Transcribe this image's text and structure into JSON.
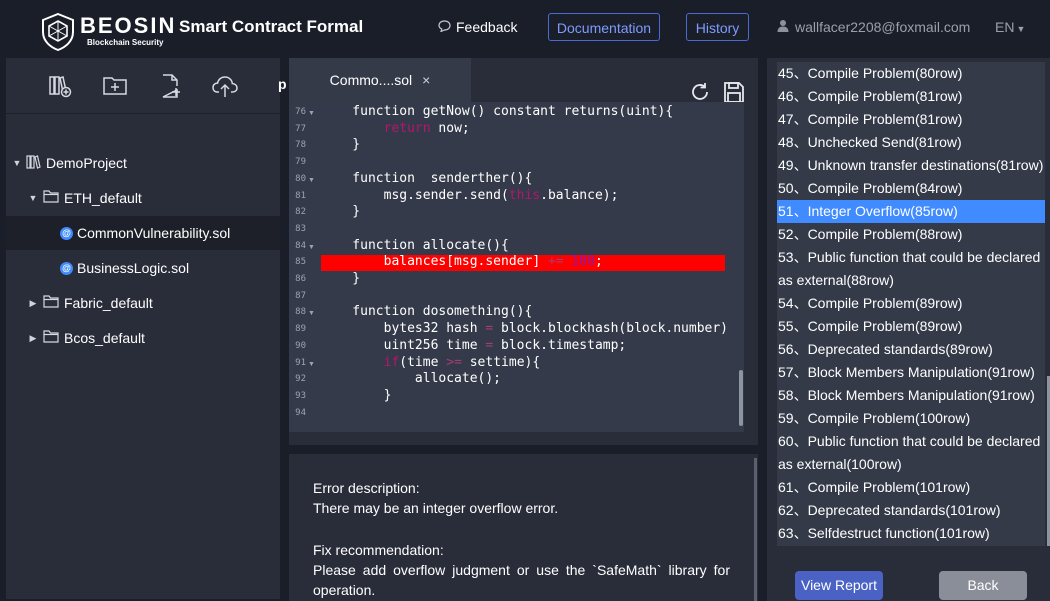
{
  "header": {
    "brand": "BEOSIN",
    "brand_sub": "Blockchain Security",
    "app_title": "Smart Contract Formal",
    "feedback_label": "Feedback",
    "documentation_label": "Documentation",
    "history_label": "History",
    "user_email": "wallfacer2208@foxmail.com",
    "language": "EN"
  },
  "colors": {
    "background": "#1a1e29",
    "panel": "#292d39",
    "accent": "#4a6bd6",
    "selected": "#3f8bff",
    "error_highlight": "#ff0000"
  },
  "toolbar": {
    "icons": [
      "library-add-icon",
      "folder-add-icon",
      "file-add-icon",
      "cloud-upload-icon"
    ],
    "overflow_text": "p"
  },
  "file_tree": [
    {
      "label": "DemoProject",
      "type": "project",
      "expanded": true
    },
    {
      "label": "ETH_default",
      "type": "folder",
      "expanded": true
    },
    {
      "label": "CommonVulnerability.sol",
      "type": "file",
      "active": true
    },
    {
      "label": "BusinessLogic.sol",
      "type": "file"
    },
    {
      "label": "Fabric_default",
      "type": "folder",
      "expanded": false
    },
    {
      "label": "Bcos_default",
      "type": "folder",
      "expanded": false
    }
  ],
  "editor": {
    "tab_label": "Commo....sol",
    "close_glyph": "×",
    "lines": [
      {
        "num": "76",
        "fold": true,
        "parts": [
          [
            "    function getNow() constant returns(uint){",
            ""
          ]
        ]
      },
      {
        "num": "77",
        "fold": false,
        "parts": [
          [
            "        ",
            ""
          ],
          [
            "return",
            "kw"
          ],
          [
            " now;",
            ""
          ]
        ]
      },
      {
        "num": "78",
        "fold": false,
        "parts": [
          [
            "    }",
            ""
          ]
        ]
      },
      {
        "num": "79",
        "fold": false,
        "parts": [
          [
            "",
            ""
          ]
        ]
      },
      {
        "num": "80",
        "fold": true,
        "parts": [
          [
            "    function  senderther(){",
            ""
          ]
        ]
      },
      {
        "num": "81",
        "fold": false,
        "parts": [
          [
            "        msg.sender.send(",
            ""
          ],
          [
            "this",
            "kw"
          ],
          [
            ".balance);",
            ""
          ]
        ]
      },
      {
        "num": "82",
        "fold": false,
        "parts": [
          [
            "    }",
            ""
          ]
        ]
      },
      {
        "num": "83",
        "fold": false,
        "parts": [
          [
            "",
            ""
          ]
        ]
      },
      {
        "num": "84",
        "fold": true,
        "parts": [
          [
            "    function allocate(){",
            ""
          ]
        ]
      },
      {
        "num": "85",
        "fold": false,
        "highlight": true,
        "parts": [
          [
            "        balances[msg.sender] ",
            ""
          ],
          [
            "+=",
            "op"
          ],
          [
            " ",
            ""
          ],
          [
            "100",
            "num"
          ],
          [
            ";",
            ""
          ]
        ]
      },
      {
        "num": "86",
        "fold": false,
        "parts": [
          [
            "    }",
            ""
          ]
        ]
      },
      {
        "num": "87",
        "fold": false,
        "parts": [
          [
            "",
            ""
          ]
        ]
      },
      {
        "num": "88",
        "fold": true,
        "parts": [
          [
            "    function dosomething(){",
            ""
          ]
        ]
      },
      {
        "num": "89",
        "fold": false,
        "parts": [
          [
            "        bytes32 hash ",
            ""
          ],
          [
            "=",
            "op"
          ],
          [
            " block.blockhash(block.number)",
            ""
          ]
        ]
      },
      {
        "num": "90",
        "fold": false,
        "parts": [
          [
            "        uint256 time ",
            ""
          ],
          [
            "=",
            "op"
          ],
          [
            " block.timestamp;",
            ""
          ]
        ]
      },
      {
        "num": "91",
        "fold": true,
        "parts": [
          [
            "        ",
            ""
          ],
          [
            "if",
            "kw"
          ],
          [
            "(time ",
            ""
          ],
          [
            ">=",
            "op"
          ],
          [
            " settime){",
            ""
          ]
        ]
      },
      {
        "num": "92",
        "fold": false,
        "parts": [
          [
            "            allocate();",
            ""
          ]
        ]
      },
      {
        "num": "93",
        "fold": false,
        "parts": [
          [
            "        }",
            ""
          ]
        ]
      },
      {
        "num": "94",
        "fold": false,
        "parts": [
          [
            "",
            ""
          ]
        ]
      }
    ]
  },
  "error": {
    "desc_heading": "Error description:",
    "desc_text": "There may be an integer overflow error.",
    "fix_heading": "Fix recommendation:",
    "fix_text": "Please add overflow judgment or use the `SafeMath` library for operation."
  },
  "issues": [
    "45、Compile Problem(80row)",
    "46、Compile Problem(81row)",
    "47、Compile Problem(81row)",
    "48、Unchecked Send(81row)",
    "49、Unknown transfer destinations(81row)",
    "50、Compile Problem(84row)",
    "51、Integer Overflow(85row)",
    "52、Compile Problem(88row)",
    "53、Public function that could be declared as external(88row)",
    "54、Compile Problem(89row)",
    "55、Compile Problem(89row)",
    "56、Deprecated standards(89row)",
    "57、Block Members Manipulation(91row)",
    "58、Block Members Manipulation(91row)",
    "59、Compile Problem(100row)",
    "60、Public function that could be declared as external(100row)",
    "61、Compile Problem(101row)",
    "62、Deprecated standards(101row)",
    "63、Selfdestruct function(101row)"
  ],
  "selected_issue": 6,
  "buttons": {
    "view_report": "View Report",
    "back": "Back"
  }
}
